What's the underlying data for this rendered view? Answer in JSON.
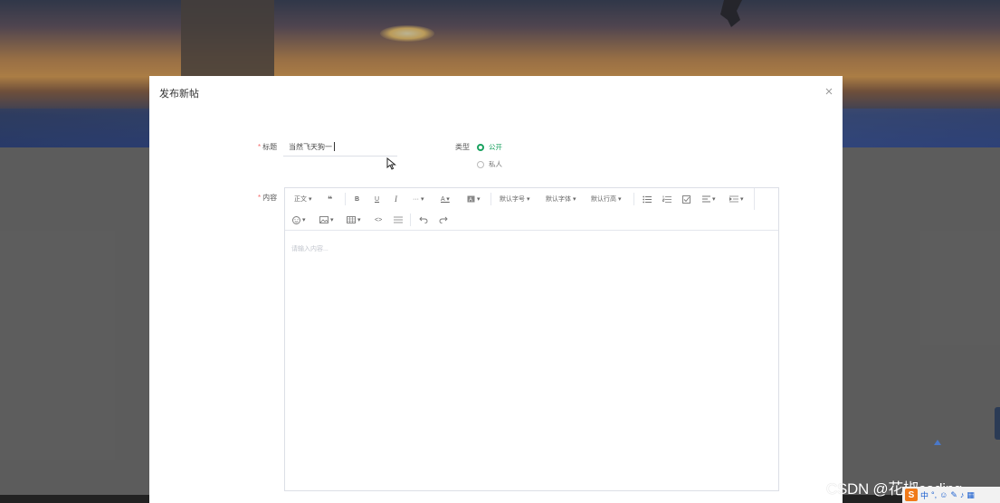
{
  "dialog": {
    "title": "发布新帖"
  },
  "form": {
    "title_label": "标题",
    "title_value": "当然飞天狗一",
    "type_label": "类型",
    "type_options": [
      "公开",
      "私人"
    ],
    "type_selected": "公开",
    "content_label": "内容",
    "content_placeholder": "请输入内容..."
  },
  "toolbar": {
    "paragraph": "正文",
    "font_size": "默认字号",
    "font_family": "默认字体",
    "line_height": "默认行高"
  },
  "watermark": "CSDN @花椒coding",
  "ime": {
    "logo": "S",
    "mode": "中"
  },
  "colors": {
    "accent": "#1aa260",
    "required": "#f56c6c"
  }
}
